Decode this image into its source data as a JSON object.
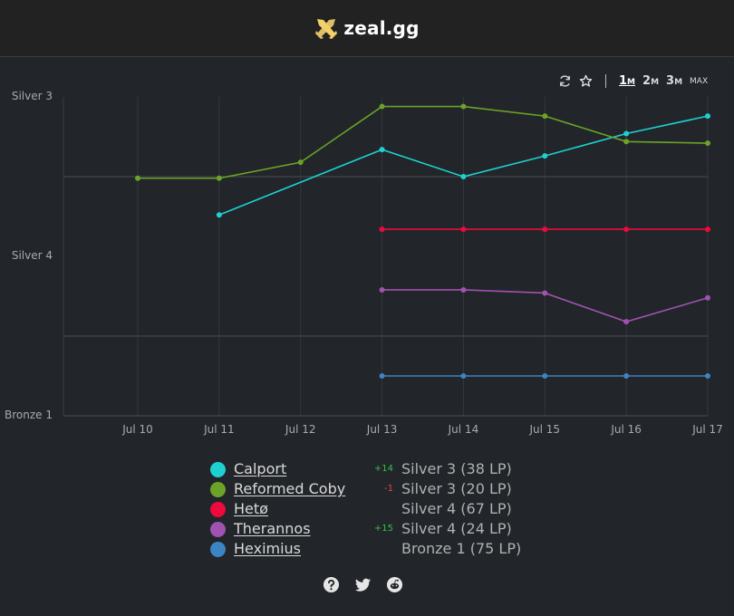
{
  "header": {
    "brand": "zeal.gg",
    "logo_icon": "crossed-swords-icon"
  },
  "toolbar": {
    "icons": [
      "refresh-icon",
      "star-icon"
    ],
    "ranges": [
      {
        "num": "1",
        "unit": "M",
        "active": true
      },
      {
        "num": "2",
        "unit": "M",
        "active": false
      },
      {
        "num": "3",
        "unit": "M",
        "active": false
      },
      {
        "num": "",
        "unit": "MAX",
        "active": false
      }
    ]
  },
  "chart_data": {
    "type": "line",
    "x": [
      "Jul 10",
      "Jul 11",
      "Jul 12",
      "Jul 13",
      "Jul 14",
      "Jul 15",
      "Jul 16",
      "Jul 17"
    ],
    "y_ticks": [
      "Silver 3",
      "Silver 4",
      "Bronze 1"
    ],
    "ylim": [
      0,
      200
    ],
    "grid": true,
    "series": [
      {
        "name": "Calport",
        "color": "#1ed1d1",
        "values": [
          null,
          126,
          null,
          167,
          150,
          163,
          177,
          188
        ]
      },
      {
        "name": "Reformed Coby",
        "color": "#6ba328",
        "values": [
          149,
          149,
          159,
          194,
          194,
          188,
          172,
          171
        ]
      },
      {
        "name": "Hetø",
        "color": "#ed0a3d",
        "values": [
          null,
          null,
          null,
          117,
          117,
          117,
          117,
          117
        ]
      },
      {
        "name": "Therannos",
        "color": "#a052b0",
        "values": [
          null,
          null,
          null,
          79,
          79,
          77,
          59,
          74
        ]
      },
      {
        "name": "Heximius",
        "color": "#3d84c2",
        "values": [
          null,
          null,
          null,
          25,
          25,
          25,
          25,
          25
        ]
      }
    ]
  },
  "legend": [
    {
      "name": "Calport",
      "color": "#1ed1d1",
      "delta": "+14",
      "delta_sign": "pos",
      "rank": "Silver 3 (38 LP)"
    },
    {
      "name": "Reformed Coby",
      "color": "#6ba328",
      "delta": "-1",
      "delta_sign": "neg",
      "rank": "Silver 3 (20 LP)"
    },
    {
      "name": "Hetø",
      "color": "#ed0a3d",
      "delta": "",
      "delta_sign": "",
      "rank": "Silver 4 (67 LP)"
    },
    {
      "name": "Therannos",
      "color": "#a052b0",
      "delta": "+15",
      "delta_sign": "pos",
      "rank": "Silver 4 (24 LP)"
    },
    {
      "name": "Heximius",
      "color": "#3d84c2",
      "delta": "",
      "delta_sign": "",
      "rank": "Bronze 1 (75 LP)"
    }
  ],
  "footer": {
    "icons": [
      "help-icon",
      "twitter-icon",
      "reddit-icon"
    ]
  }
}
